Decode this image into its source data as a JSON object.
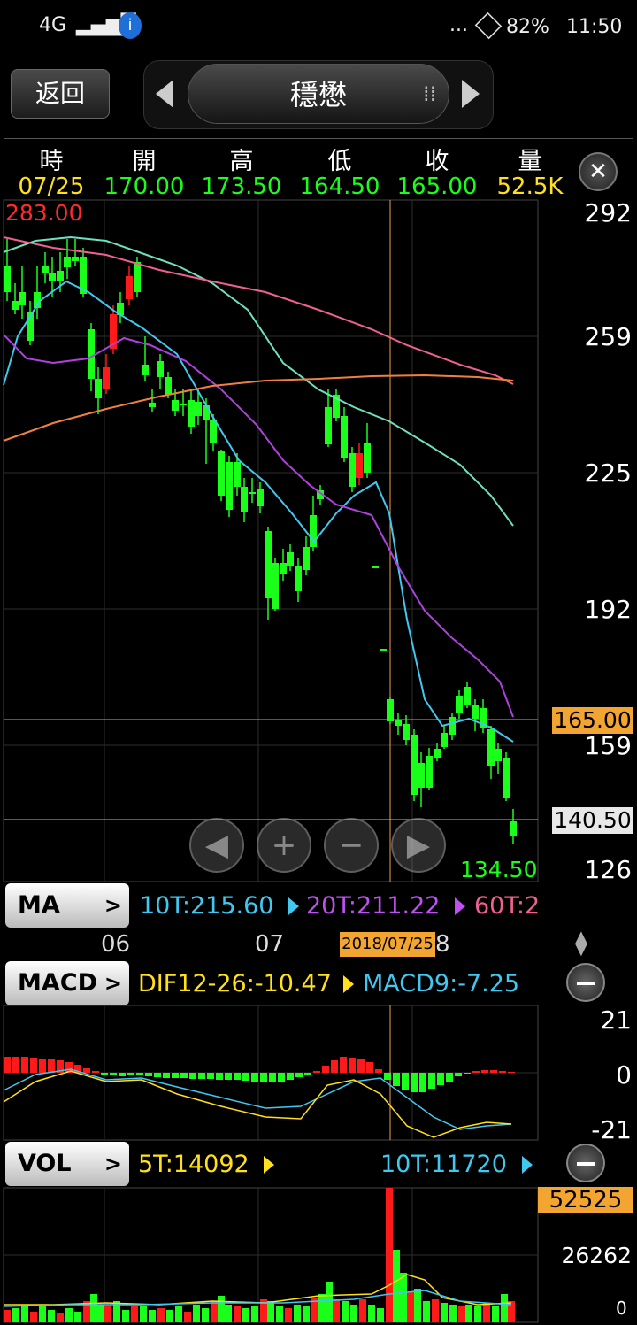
{
  "status_bar": {
    "network": "4G",
    "battery": "82%",
    "time": "11:50",
    "dots": "..."
  },
  "header": {
    "back_label": "返回",
    "stock_name": "穩懋"
  },
  "quote": {
    "labels": {
      "time": "時",
      "open": "開",
      "high": "高",
      "low": "低",
      "close": "收",
      "volume": "量"
    },
    "values": {
      "time": "07/25",
      "open": "170.00",
      "high": "173.50",
      "low": "164.50",
      "close": "165.00",
      "volume": "52.5K"
    },
    "close_icon": "close-icon"
  },
  "price_chart": {
    "max_label": "283.00",
    "min_label": "134.50",
    "y_ticks": [
      "292",
      "259",
      "225",
      "192",
      "159",
      "126"
    ],
    "cursor_price": "165.00",
    "last_price": "140.50"
  },
  "ma": {
    "button": "MA",
    "chevron": ">",
    "ma10": "10T:215.60",
    "ma20": "20T:211.22",
    "ma60": "60T:2"
  },
  "time_axis": {
    "labels": [
      "06",
      "07",
      "8"
    ],
    "cursor_date": "2018/07/25"
  },
  "macd": {
    "button": "MACD",
    "chevron": ">",
    "dif": "DIF12-26:-10.47",
    "macd9": "MACD9:-7.25",
    "y_ticks": [
      "21",
      "0",
      "-21"
    ]
  },
  "vol": {
    "button": "VOL",
    "chevron": ">",
    "ma5": "5T:14092",
    "ma10": "10T:11720",
    "y_ticks": [
      "52525",
      "26262",
      "0"
    ]
  },
  "colors": {
    "up": "#ff1a1a",
    "down": "#1aff1a",
    "ma10": "#40c8f0",
    "ma20": "#b040e0",
    "ma60": "#f06090",
    "ma120": "#f08040",
    "cursor": "#f0a050",
    "highlight": "#f3a531"
  }
}
